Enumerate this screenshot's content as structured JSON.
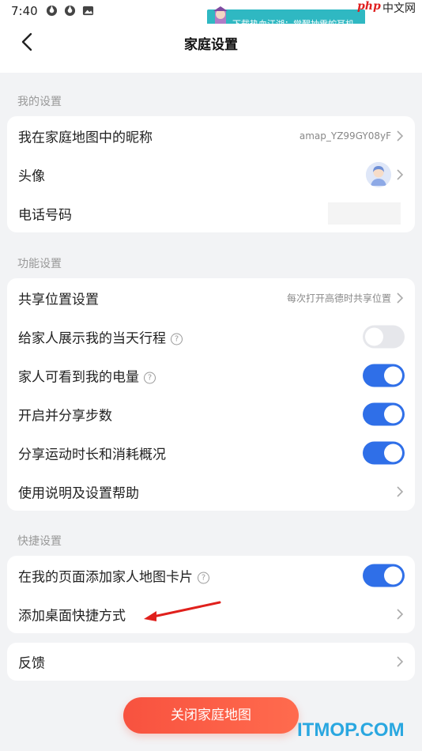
{
  "status_bar": {
    "time": "7:40",
    "icons": [
      "spinner-icon",
      "spinner-icon",
      "image-icon"
    ]
  },
  "ad_banner": {
    "text": "下载热血江湖：觉醒抽雷蛇耳机"
  },
  "watermark": {
    "php": "php",
    "cn": "中文网",
    "site": "ITMOP.COM"
  },
  "nav": {
    "title": "家庭设置",
    "back_icon": "chevron-left-icon"
  },
  "sections": {
    "my_settings": {
      "header": "我的设置",
      "nickname_label": "我在家庭地图中的昵称",
      "nickname_value": "amap_YZ99GY08yF",
      "avatar_label": "头像",
      "phone_label": "电话号码"
    },
    "function_settings": {
      "header": "功能设置",
      "share_location_label": "共享位置设置",
      "share_location_value": "每次打开高德时共享位置",
      "show_trip_label": "给家人展示我的当天行程",
      "show_trip_enabled": false,
      "battery_label": "家人可看到我的电量",
      "battery_enabled": true,
      "steps_label": "开启并分享步数",
      "steps_enabled": true,
      "exercise_label": "分享运动时长和消耗概况",
      "exercise_enabled": true,
      "help_label": "使用说明及设置帮助"
    },
    "shortcut_settings": {
      "header": "快捷设置",
      "map_card_label": "在我的页面添加家人地图卡片",
      "map_card_enabled": true,
      "desktop_shortcut_label": "添加桌面快捷方式"
    },
    "feedback": {
      "label": "反馈"
    }
  },
  "close_button": {
    "label": "关闭家庭地图"
  },
  "colors": {
    "toggle_on": "#2f6fe8",
    "toggle_off": "#e6e7eb",
    "close_button": "#f8523f",
    "background": "#f2f3f5",
    "annotation_arrow": "#e0201c"
  }
}
